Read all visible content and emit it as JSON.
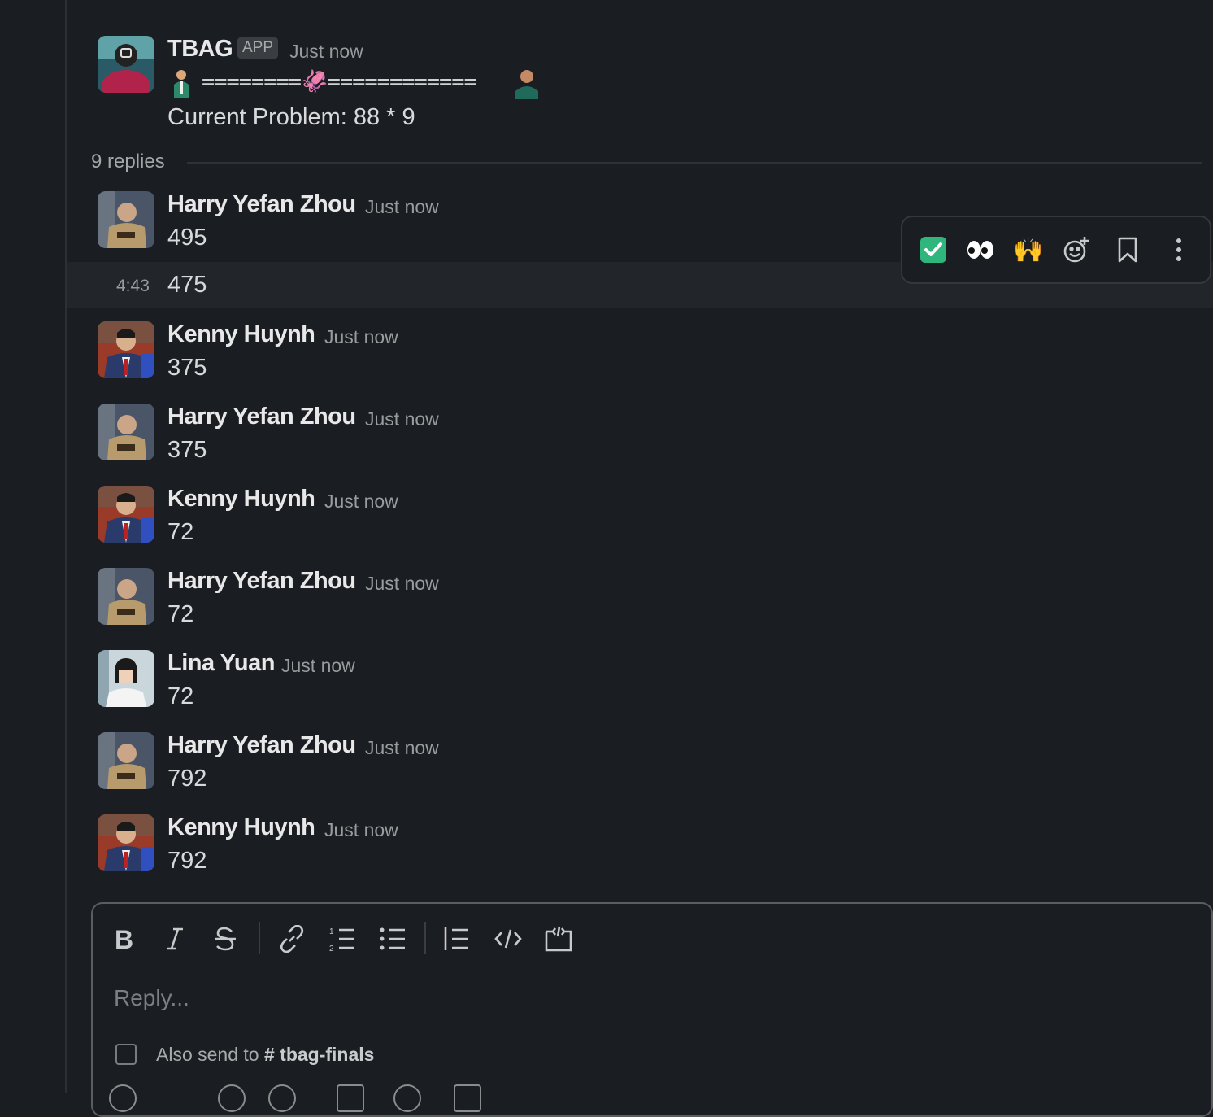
{
  "thread": {
    "parent": {
      "author": "TBAG",
      "badge": "APP",
      "time": "Just now",
      "race_line": "========🦑============",
      "problem": "Current Problem: 88 * 9"
    },
    "replies_label": "9 replies",
    "messages": [
      {
        "author": "Harry Yefan Zhou",
        "time": "Just now",
        "text": "495"
      },
      {
        "author": "",
        "time": "4:43",
        "text": "475"
      },
      {
        "author": "Kenny Huynh",
        "time": "Just now",
        "text": "375"
      },
      {
        "author": "Harry Yefan Zhou",
        "time": "Just now",
        "text": "375"
      },
      {
        "author": "Kenny Huynh",
        "time": "Just now",
        "text": "72"
      },
      {
        "author": "Harry Yefan Zhou",
        "time": "Just now",
        "text": "72"
      },
      {
        "author": "Lina Yuan",
        "time": "Just now",
        "text": "72"
      },
      {
        "author": "Harry Yefan Zhou",
        "time": "Just now",
        "text": "792"
      },
      {
        "author": "Kenny Huynh",
        "time": "Just now",
        "text": "792"
      }
    ]
  },
  "hover_toolbar": {
    "icons": [
      "check-mark-reaction-icon",
      "eyes-reaction-icon",
      "raised-hands-reaction-icon",
      "add-reaction-icon",
      "bookmark-icon",
      "more-actions-icon"
    ],
    "emoji": {
      "eyes": "👀",
      "raised_hands": "🙌"
    }
  },
  "composer": {
    "placeholder": "Reply...",
    "also_send_prefix": "Also send to",
    "channel": "# tbag-finals",
    "format_icons": [
      "bold-icon",
      "italic-icon",
      "strikethrough-icon",
      "link-icon",
      "ordered-list-icon",
      "bulleted-list-icon",
      "blockquote-icon",
      "code-icon",
      "code-block-icon"
    ]
  },
  "colors": {
    "background": "#1a1d21",
    "hover_row": "#222529",
    "check_green": "#2eb67d"
  }
}
